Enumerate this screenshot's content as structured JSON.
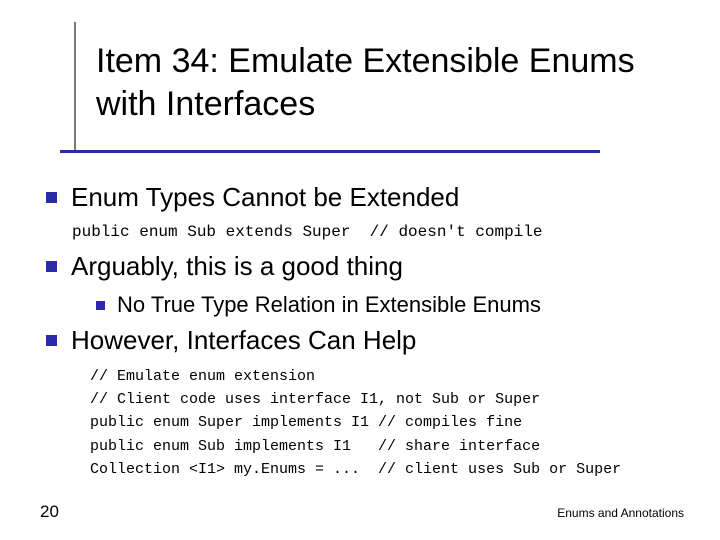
{
  "title": "Item 34: Emulate Extensible Enums with Interfaces",
  "points": {
    "p1": "Enum Types Cannot be Extended",
    "code1": "public enum Sub extends Super  // doesn't compile",
    "p2": "Arguably, this is a good thing",
    "p2a": "No True Type Relation in Extensible Enums",
    "p3": "However, Interfaces Can Help",
    "code2": "// Emulate enum extension\n// Client code uses interface I1, not Sub or Super\npublic enum Super implements I1 // compiles fine\npublic enum Sub implements I1   // share interface\nCollection <I1> my.Enums = ...  // client uses Sub or Super"
  },
  "footer": {
    "page": "20",
    "label": "Enums and Annotations"
  }
}
